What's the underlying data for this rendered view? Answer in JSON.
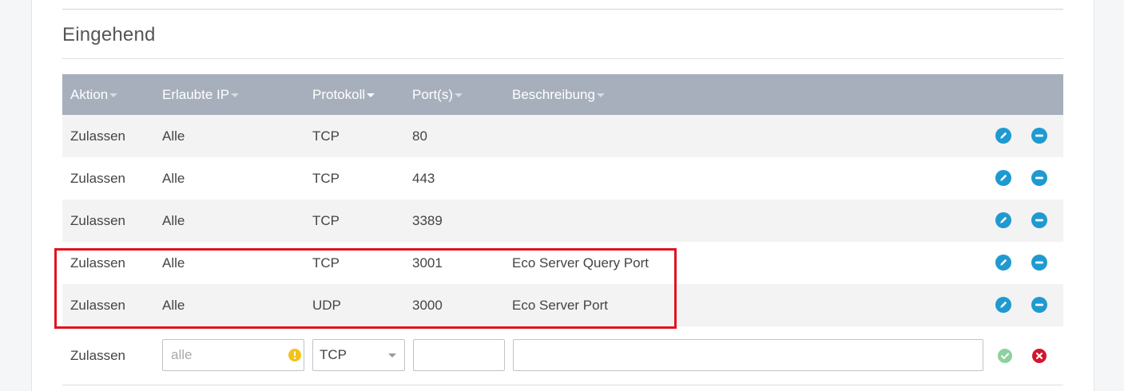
{
  "section": {
    "title": "Eingehend"
  },
  "table": {
    "columns": [
      {
        "label": "Aktion",
        "key": "aktion"
      },
      {
        "label": "Erlaubte IP",
        "key": "ip"
      },
      {
        "label": "Protokoll",
        "key": "protokoll"
      },
      {
        "label": "Port(s)",
        "key": "port"
      },
      {
        "label": "Beschreibung",
        "key": "beschreibung"
      }
    ],
    "rows": [
      {
        "aktion": "Zulassen",
        "ip": "Alle",
        "protokoll": "TCP",
        "port": "80",
        "beschreibung": ""
      },
      {
        "aktion": "Zulassen",
        "ip": "Alle",
        "protokoll": "TCP",
        "port": "443",
        "beschreibung": ""
      },
      {
        "aktion": "Zulassen",
        "ip": "Alle",
        "protokoll": "TCP",
        "port": "3389",
        "beschreibung": ""
      },
      {
        "aktion": "Zulassen",
        "ip": "Alle",
        "protokoll": "TCP",
        "port": "3001",
        "beschreibung": "Eco Server Query Port"
      },
      {
        "aktion": "Zulassen",
        "ip": "Alle",
        "protokoll": "UDP",
        "port": "3000",
        "beschreibung": "Eco Server Port"
      }
    ],
    "new_row": {
      "aktion": "Zulassen",
      "ip_placeholder": "alle",
      "ip_value": "",
      "protokoll_selected": "TCP",
      "port_value": "",
      "beschreibung_value": ""
    }
  },
  "icons": {
    "edit": "pencil-icon",
    "remove": "minus-circle-icon",
    "confirm": "check-circle-icon",
    "cancel": "x-circle-icon",
    "warning": "exclamation-circle-icon",
    "sort": "caret-down-icon"
  },
  "colors": {
    "header_bg": "#a7afbd",
    "action_blue": "#1f9ad1",
    "confirm_green": "#8fd19e",
    "cancel_red": "#d5162b",
    "warning_yellow": "#f3c316",
    "highlight_red": "#e0141e"
  }
}
